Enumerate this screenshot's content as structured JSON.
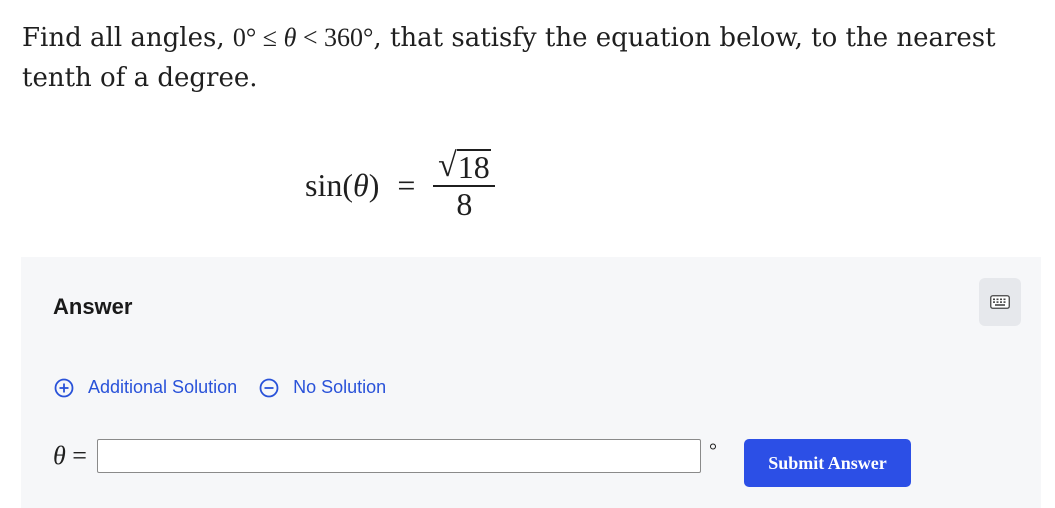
{
  "question": {
    "text_before": "Find all angles, ",
    "math": "0° ≤ θ < 360°",
    "math_parts": {
      "lower": "0°",
      "le": "≤",
      "var": "θ",
      "lt": "<",
      "upper": "360°"
    },
    "text_after": ", that satisfy the equation below, to the nearest tenth of a degree."
  },
  "equation": {
    "lhs_func": "sin(",
    "lhs_var": "θ",
    "lhs_close": ")",
    "equals": "=",
    "radical_symbol": "√",
    "radicand": "18",
    "denominator": "8"
  },
  "answer_panel": {
    "title": "Answer",
    "keyboard_icon": "keyboard-icon",
    "options": [
      {
        "label": "Additional Solution",
        "icon": "plus-circle-icon"
      },
      {
        "label": "No Solution",
        "icon": "minus-circle-icon"
      }
    ],
    "input_label_var": "θ",
    "input_label_eq": "=",
    "input_value": "",
    "input_placeholder": "",
    "unit": "°",
    "submit_label": "Submit Answer"
  },
  "colors": {
    "accent": "#2c4fe6",
    "link": "#2952d9",
    "panel_bg": "#f6f7f9"
  }
}
